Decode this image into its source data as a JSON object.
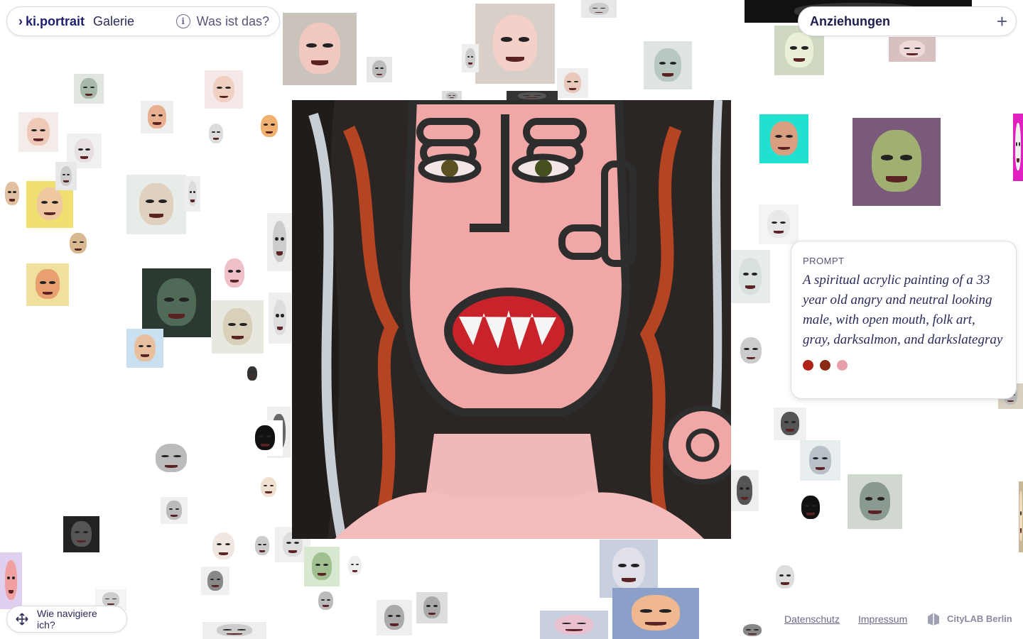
{
  "nav": {
    "brand_label": "ki.portrait",
    "gallery_label": "Galerie",
    "info_label": "Was ist das?"
  },
  "filter": {
    "label": "Anziehungen"
  },
  "prompt": {
    "heading": "PROMPT",
    "text": "A spiritual acrylic painting of a 33 year old angry and neutral looking male, with open mouth, folk art, gray, darksalmon, and darkslategray",
    "swatches": [
      "#b02418",
      "#8a2a12",
      "#e8a0a8"
    ]
  },
  "help": {
    "label": "Wie navigiere ich?"
  },
  "footer": {
    "privacy_label": "Datenschutz",
    "imprint_label": "Impressum",
    "org_label": "CityLAB Berlin"
  },
  "colors": {
    "accent": "#1e1e6e",
    "card_border": "#d8d8e6"
  }
}
